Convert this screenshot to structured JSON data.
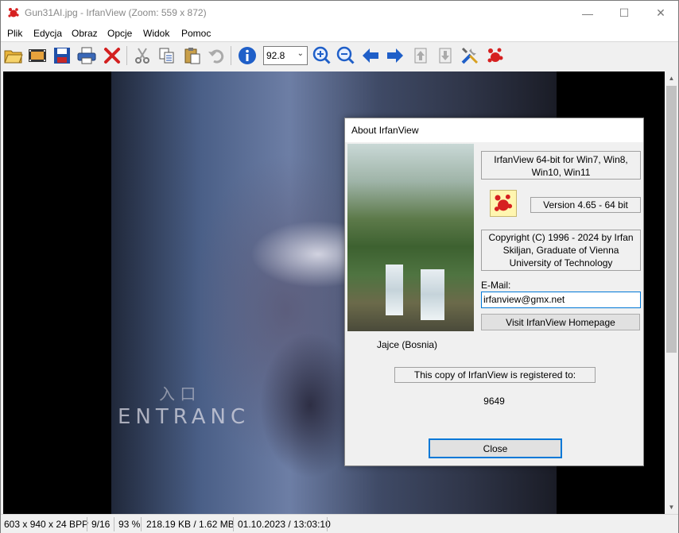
{
  "window": {
    "title": "Gun31AI.jpg - IrfanView (Zoom: 559 x 872)",
    "controls": {
      "minimize": "—",
      "maximize": "☐",
      "close": "✕"
    }
  },
  "menu": {
    "items": [
      "Plik",
      "Edycja",
      "Obraz",
      "Opcje",
      "Widok",
      "Pomoc"
    ]
  },
  "toolbar": {
    "zoom_value": "92.8",
    "buttons": [
      "open-icon",
      "slideshow-icon",
      "save-icon",
      "print-icon",
      "delete-icon",
      "cut-icon",
      "copy-icon",
      "paste-icon",
      "undo-icon",
      "info-icon",
      "zoom-in-icon",
      "zoom-out-icon",
      "previous-icon",
      "next-icon",
      "first-page-icon",
      "last-page-icon",
      "settings-icon",
      "irfanview-logo-icon"
    ]
  },
  "image_overlay": {
    "text_line1": "入 口",
    "text_line2": "ENTRANC"
  },
  "status": {
    "dimensions": "603 x 940 x 24 BPP",
    "index": "9/16",
    "zoom": "93 %",
    "size": "218.19 KB / 1.62 MB",
    "datetime": "01.10.2023 / 13:03:10"
  },
  "about_dialog": {
    "title": "About  IrfanView",
    "product_name": "IrfanView 64-bit for Win7, Win8, Win10, Win11",
    "version": "Version 4.65 - 64 bit",
    "copyright": "Copyright (C) 1996 - 2024 by Irfan Skiljan, Graduate of Vienna University of Technology",
    "email_label": "E-Mail:",
    "email_value": "irfanview@gmx.net",
    "homepage_button": "Visit IrfanView Homepage",
    "photo_caption": "Jajce (Bosnia)",
    "registered_text": "This copy of IrfanView is registered to:",
    "registration_number": "9649",
    "close_button": "Close"
  },
  "colors": {
    "accent": "#0078d7",
    "background": "#f0f0f0",
    "viewer": "#000000"
  }
}
